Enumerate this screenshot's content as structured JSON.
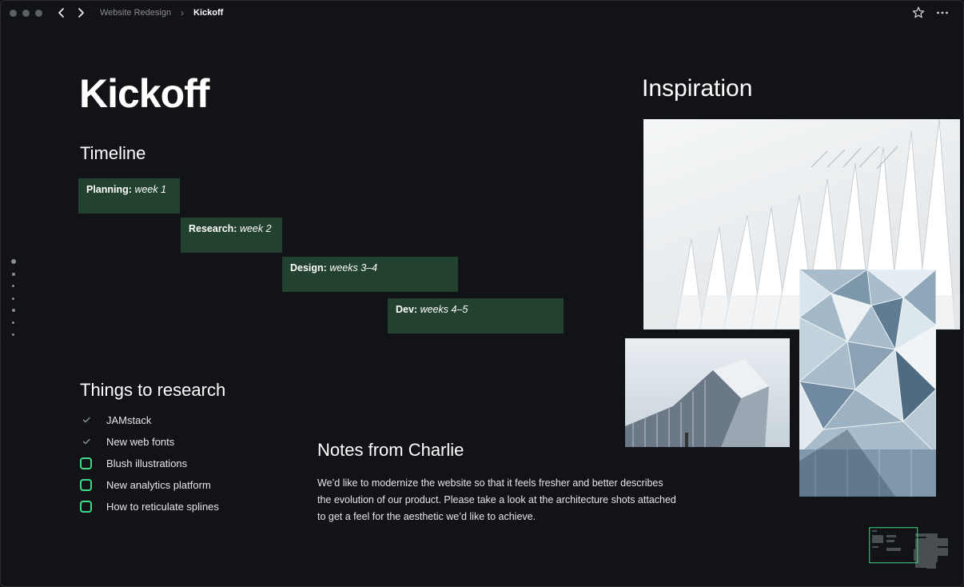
{
  "breadcrumb": {
    "parent": "Website Redesign",
    "current": "Kickoff"
  },
  "page": {
    "title": "Kickoff"
  },
  "timeline": {
    "heading": "Timeline",
    "phases": [
      {
        "name": "Planning:",
        "duration": "week 1"
      },
      {
        "name": "Research:",
        "duration": "week 2"
      },
      {
        "name": "Design:",
        "duration": "weeks 3–4"
      },
      {
        "name": "Dev:",
        "duration": "weeks 4–5"
      }
    ]
  },
  "research": {
    "heading": "Things to research",
    "items": [
      {
        "label": "JAMstack",
        "done": true
      },
      {
        "label": "New web fonts",
        "done": true
      },
      {
        "label": "Blush illustrations",
        "done": false
      },
      {
        "label": "New analytics platform",
        "done": false
      },
      {
        "label": "How to reticulate splines",
        "done": false
      }
    ]
  },
  "notes": {
    "heading": "Notes from Charlie",
    "body": "We’d like to modernize the website so that it feels fresher and better describes the evolution of our product. Please take a look at the architecture shots attached to get a feel for the aesthetic we’d like to achieve."
  },
  "inspiration": {
    "heading": "Inspiration"
  },
  "colors": {
    "background": "#121316",
    "phase_fill": "#22412f",
    "accent_green": "#3ddc84"
  },
  "icons": {
    "back": "chevron-left-icon",
    "forward": "chevron-right-icon",
    "favorite": "star-icon",
    "more": "ellipsis-icon"
  }
}
